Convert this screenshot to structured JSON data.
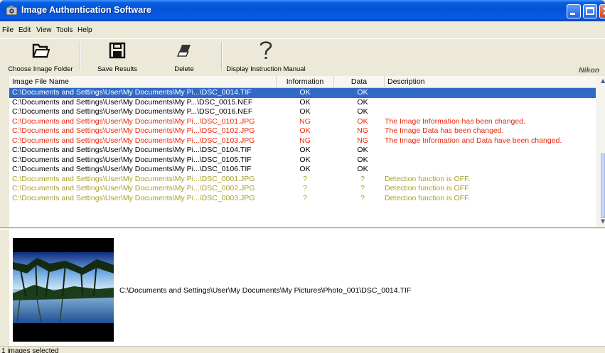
{
  "window": {
    "title": "Image Authentication Software"
  },
  "menu": [
    "File",
    "Edit",
    "View",
    "Tools",
    "Help"
  ],
  "toolbar": {
    "choose_folder": "Choose Image Folder",
    "save_results": "Save Results",
    "delete": "Delete",
    "manual": "Display Instruction Manual",
    "brand": "Nikon"
  },
  "list": {
    "columns": [
      "Image File Name",
      "Information",
      "Data",
      "Description"
    ],
    "rows": [
      {
        "name": "C:\\Documents and Settings\\User\\My Documents\\My Pi...\\DSC_0014.TIF",
        "info": "OK",
        "data": "OK",
        "desc": ""
      },
      {
        "name": "C:\\Documents and Settings\\User\\My Documents\\My P...\\DSC_0015.NEF",
        "info": "OK",
        "data": "OK",
        "desc": ""
      },
      {
        "name": "C:\\Documents and Settings\\User\\My Documents\\My P...\\DSC_0016.NEF",
        "info": "OK",
        "data": "OK",
        "desc": ""
      },
      {
        "name": "C:\\Documents and Settings\\User\\My Documents\\My Pi...\\DSC_0101.JPG",
        "info": "NG",
        "data": "OK",
        "desc": "The Image Information has been changed."
      },
      {
        "name": "C:\\Documents and Settings\\User\\My Documents\\My Pi...\\DSC_0102.JPG",
        "info": "OK",
        "data": "NG",
        "desc": "The Image Data has been changed."
      },
      {
        "name": "C:\\Documents and Settings\\User\\My Documents\\My Pi...\\DSC_0103.JPG",
        "info": "NG",
        "data": "NG",
        "desc": "The Image Information and Data have been changed."
      },
      {
        "name": "C:\\Documents and Settings\\User\\My Documents\\My Pi...\\DSC_0104.TIF",
        "info": "OK",
        "data": "OK",
        "desc": ""
      },
      {
        "name": "C:\\Documents and Settings\\User\\My Documents\\My Pi...\\DSC_0105.TIF",
        "info": "OK",
        "data": "OK",
        "desc": ""
      },
      {
        "name": "C:\\Documents and Settings\\User\\My Documents\\My Pi...\\DSC_0106.TIF",
        "info": "OK",
        "data": "OK",
        "desc": ""
      },
      {
        "name": "C:\\Documents and Settings\\User\\My Documents\\My Pi...\\DSC_0001.JPG",
        "info": "?",
        "data": "?",
        "desc": "Detection function is OFF."
      },
      {
        "name": "C:\\Documents and Settings\\User\\My Documents\\My Pi...\\DSC_0002.JPG",
        "info": "?",
        "data": "?",
        "desc": "Detection function is OFF."
      },
      {
        "name": "C:\\Documents and Settings\\User\\My Documents\\My Pi...\\DSC_0003.JPG",
        "info": "?",
        "data": "?",
        "desc": "Detection function is OFF."
      }
    ]
  },
  "preview": {
    "path": "C:\\Documents and Settings\\User\\My Documents\\My Pictures\\Photo_001\\DSC_0014.TIF"
  },
  "status": {
    "text": "1 images selected"
  },
  "colors": {
    "selected_row": "#316ac5",
    "changed": "#e8280c",
    "unknown": "#a8a028",
    "titlebar": "#0453d6"
  },
  "icons": [
    "app-icon",
    "folder-icon",
    "save-icon",
    "eraser-icon",
    "help-icon",
    "minimize-icon",
    "maximize-icon",
    "close-icon"
  ]
}
